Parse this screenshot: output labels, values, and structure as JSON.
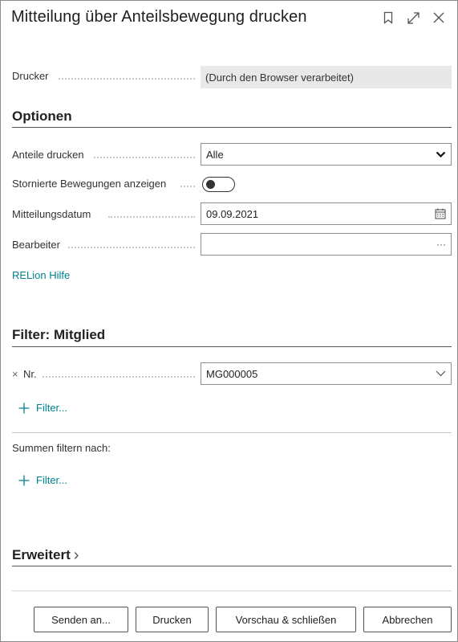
{
  "dialog": {
    "title": "Mitteilung über Anteilsbewegung drucken"
  },
  "drucker": {
    "label": "Drucker",
    "value": "(Durch den Browser verarbeitet)"
  },
  "optionen": {
    "title": "Optionen",
    "anteile_label": "Anteile drucken",
    "anteile_value": "Alle",
    "storniert_label": "Stornierte Bewegungen anzeigen",
    "storniert_on": false,
    "mitteilungsdatum_label": "Mitteilungsdatum",
    "mitteilungsdatum_value": "09.09.2021",
    "bearbeiter_label": "Bearbeiter",
    "bearbeiter_value": "",
    "bearbeiter_trail": "···",
    "hilfe_link": "RELion Hilfe"
  },
  "filter_mitglied": {
    "title": "Filter: Mitglied",
    "remove_symbol": "×",
    "nr_label": "Nr.",
    "nr_value": "MG000005",
    "add_filter": "Filter..."
  },
  "summen": {
    "title": "Summen filtern nach:",
    "add_filter": "Filter..."
  },
  "erweitert": {
    "title": "Erweitert",
    "chevron": "›"
  },
  "buttons": {
    "senden": "Senden an...",
    "drucken": "Drucken",
    "vorschau": "Vorschau & schließen",
    "abbrechen": "Abbrechen"
  }
}
